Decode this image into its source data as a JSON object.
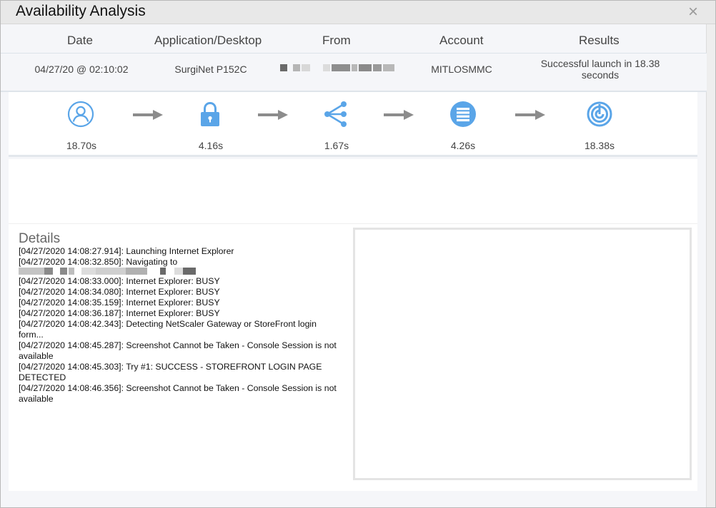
{
  "window": {
    "title": "Availability Analysis",
    "close_icon": "×"
  },
  "table": {
    "headers": [
      "Date",
      "Application/Desktop",
      "From",
      "Account",
      "Results"
    ],
    "row": {
      "date": "04/27/20 @ 02:10:02",
      "application": "SurgiNet P152C",
      "account": "MITLOSMMC",
      "results": "Successful launch in 18.38 seconds"
    }
  },
  "steps": [
    {
      "icon": "user-icon",
      "time": "18.70s"
    },
    {
      "icon": "lock-icon",
      "time": "4.16s"
    },
    {
      "icon": "share-icon",
      "time": "1.67s"
    },
    {
      "icon": "list-icon",
      "time": "4.26s"
    },
    {
      "icon": "target-icon",
      "time": "18.38s"
    }
  ],
  "colors": {
    "accent": "#5aa5e8",
    "arrow": "#8c8c8c"
  },
  "details": {
    "title": "Details",
    "log": [
      "[04/27/2020 14:08:27.914]: Launching Internet Explorer",
      "[04/27/2020 14:08:32.850]: Navigating to",
      "",
      "[04/27/2020 14:08:33.000]: Internet Explorer: BUSY",
      "[04/27/2020 14:08:34.080]: Internet Explorer: BUSY",
      "[04/27/2020 14:08:35.159]: Internet Explorer: BUSY",
      "[04/27/2020 14:08:36.187]: Internet Explorer: BUSY",
      "[04/27/2020 14:08:42.343]: Detecting NetScaler Gateway or StoreFront login form...",
      "[04/27/2020 14:08:45.287]: Screenshot Cannot be Taken - Console Session is not available",
      "[04/27/2020 14:08:45.303]: Try #1: SUCCESS - STOREFRONT LOGIN PAGE DETECTED",
      "[04/27/2020 14:08:46.356]: Screenshot Cannot be Taken - Console Session is not available"
    ]
  }
}
